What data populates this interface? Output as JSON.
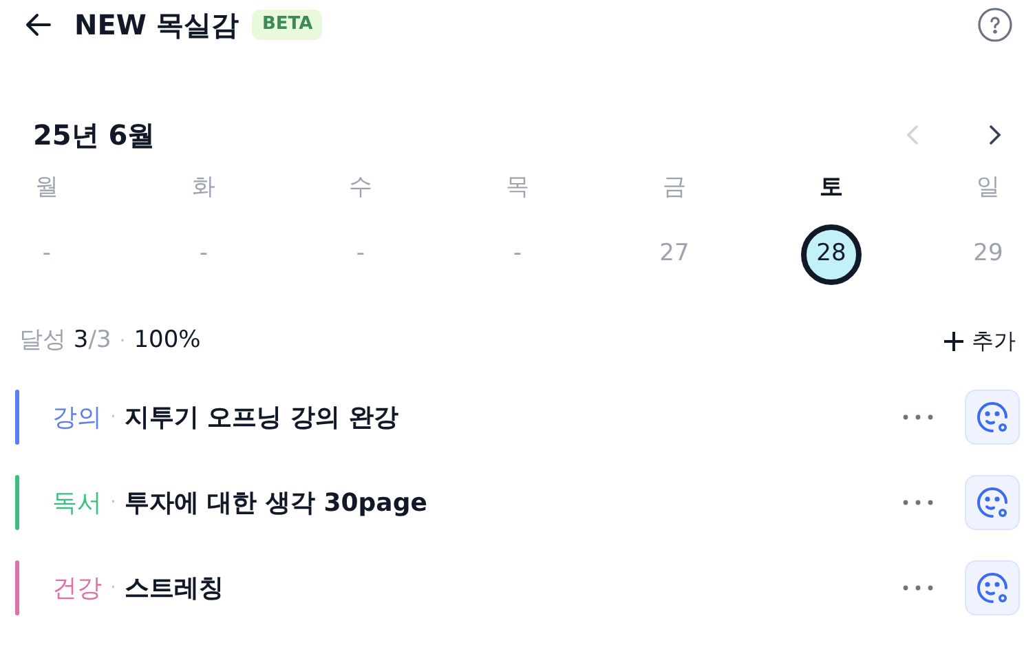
{
  "header": {
    "title": "NEW 목실감",
    "badge": "BETA"
  },
  "calendar": {
    "month": "25년 6월",
    "prev_disabled": true,
    "next_disabled": false,
    "days": [
      {
        "weekday": "월",
        "date": "-",
        "selected": false
      },
      {
        "weekday": "화",
        "date": "-",
        "selected": false
      },
      {
        "weekday": "수",
        "date": "-",
        "selected": false
      },
      {
        "weekday": "목",
        "date": "-",
        "selected": false
      },
      {
        "weekday": "금",
        "date": "27",
        "selected": false
      },
      {
        "weekday": "토",
        "date": "28",
        "selected": true
      },
      {
        "weekday": "일",
        "date": "29",
        "selected": false
      }
    ]
  },
  "summary": {
    "label": "달성",
    "done": "3",
    "total": "/3",
    "separator": "·",
    "percent": "100%",
    "add": "추가"
  },
  "tasks": [
    {
      "category": "강의",
      "separator": "·",
      "title": "지투기 오프닝 강의 완강",
      "color": "#5b7ff0"
    },
    {
      "category": "독서",
      "separator": "·",
      "title": "투자에 대한 생각 30page",
      "color": "#3fbf7f"
    },
    {
      "category": "건강",
      "separator": "·",
      "title": "스트레칭",
      "color": "#e070a8"
    }
  ]
}
